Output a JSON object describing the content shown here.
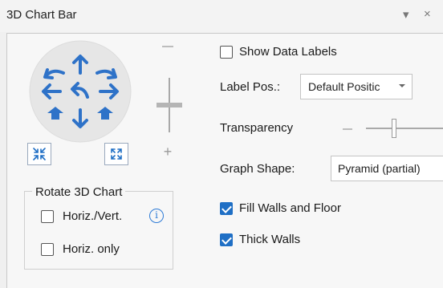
{
  "window": {
    "title": "3D Chart Bar",
    "menu_glyph": "▾",
    "close_glyph": "×"
  },
  "rotation_wheel": {
    "icons": [
      "rotate-up-icon",
      "tilt-up-icon",
      "rotate-down-icon",
      "rotate-left-icon",
      "undo-rotation-icon",
      "rotate-right-icon",
      "tilt-left-icon",
      "tilt-down-icon",
      "tilt-right-icon"
    ]
  },
  "zoom": {
    "minus": "−",
    "plus": "+"
  },
  "buttons": {
    "shrink": "shrink-arrows-icon",
    "expand": "expand-arrows-icon"
  },
  "rotate_group": {
    "title": "Rotate 3D Chart",
    "horiz_vert": {
      "label": "Horiz./Vert.",
      "checked": false
    },
    "horiz_only": {
      "label": "Horiz. only",
      "checked": false
    },
    "info": "i"
  },
  "options": {
    "show_data_labels": {
      "label": "Show Data Labels",
      "checked": false
    },
    "label_pos": {
      "label": "Label Pos.:",
      "value": "Default Positic"
    },
    "transparency": {
      "label": "Transparency",
      "value": 0.33
    },
    "graph_shape": {
      "label": "Graph Shape:",
      "value": "Pyramid (partial)"
    },
    "fill_walls": {
      "label": "Fill Walls and Floor",
      "checked": true
    },
    "thick_walls": {
      "label": "Thick Walls",
      "checked": true
    }
  },
  "colors": {
    "accent": "#1f6fc5",
    "wheel_fill": "#e6e6e6",
    "icon_blue": "#2e72c8"
  }
}
